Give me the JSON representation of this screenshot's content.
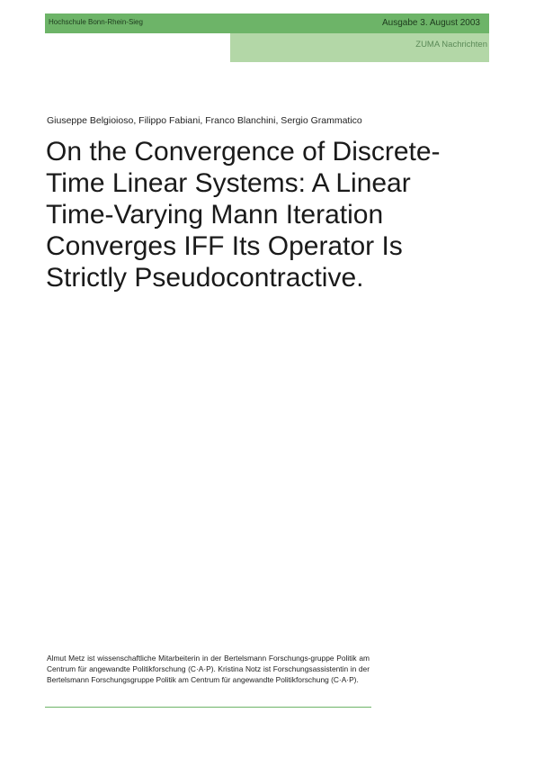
{
  "header": {
    "institution": "Hochschule Bonn-Rhein-Sieg",
    "issue": "Ausgabe 3. August 2003",
    "series": "ZUMA Nachrichten"
  },
  "article": {
    "authors": "Giuseppe Belgioioso, Filippo Fabiani, Franco Blanchini, Sergio Grammatico",
    "title": "On the Convergence of Discrete-Time Linear Systems: A Linear Time-Varying Mann Iteration Converges IFF Its Operator Is Strictly Pseudocontractive."
  },
  "footnote": {
    "text": "Almut Metz ist wissenschaftliche Mitarbeiterin in der Bertelsmann Forschungs-gruppe Politik am Centrum für angewandte Politikforschung (C·A·P). Kristina Notz ist Forschungsassistentin in der Bertelsmann Forschungsgruppe Politik am Centrum für angewandte Politikforschung (C·A·P)."
  },
  "colors": {
    "band_dark": "#6db468",
    "band_light": "#b3d7a7"
  }
}
